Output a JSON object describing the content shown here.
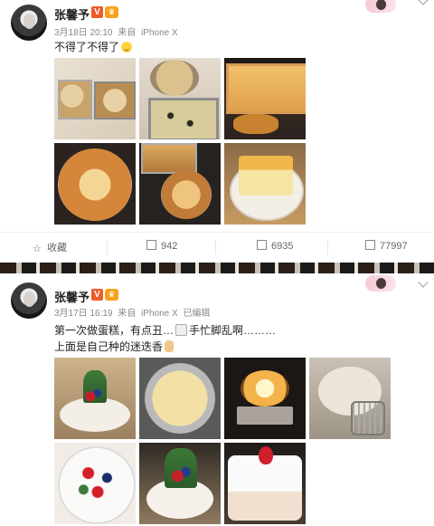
{
  "post1": {
    "author": "张馨予",
    "verified_badge": "V",
    "member_badge": "♛",
    "date": "3月18日 20:10",
    "source_prefix": "来自",
    "source": "iPhone X",
    "text": "不得了不得了",
    "photos": [
      {
        "name": "photo-dough-in-pans"
      },
      {
        "name": "photo-buns-in-tins"
      },
      {
        "name": "photo-oven-bread"
      },
      {
        "name": "photo-round-bread"
      },
      {
        "name": "photo-bread-in-oven-tray"
      },
      {
        "name": "photo-sliced-cake"
      }
    ],
    "actions": {
      "favorite": "收藏",
      "repost": "942",
      "comment": "6935",
      "like": "77997"
    }
  },
  "post2": {
    "author": "张馨予",
    "verified_badge": "V",
    "member_badge": "♛",
    "date": "3月17日 16:19",
    "source_prefix": "来自",
    "source": "iPhone X",
    "edited": "已编辑",
    "text_line1a": "第一次做蛋糕，有点丑…",
    "text_line1b": "手忙脚乱啊………",
    "text_line2": "上面是自己种的迷迭香",
    "photos": [
      {
        "name": "photo-cake-rosemary"
      },
      {
        "name": "photo-batter-bowl"
      },
      {
        "name": "photo-cake-in-oven"
      },
      {
        "name": "photo-whipped-cream"
      },
      {
        "name": "photo-cake-top-berries"
      },
      {
        "name": "photo-cake-decorated"
      },
      {
        "name": "photo-cake-slice"
      }
    ]
  },
  "colors": {
    "verified": "#f05a28",
    "member": "#f6a11a",
    "meta_text": "#888888"
  }
}
